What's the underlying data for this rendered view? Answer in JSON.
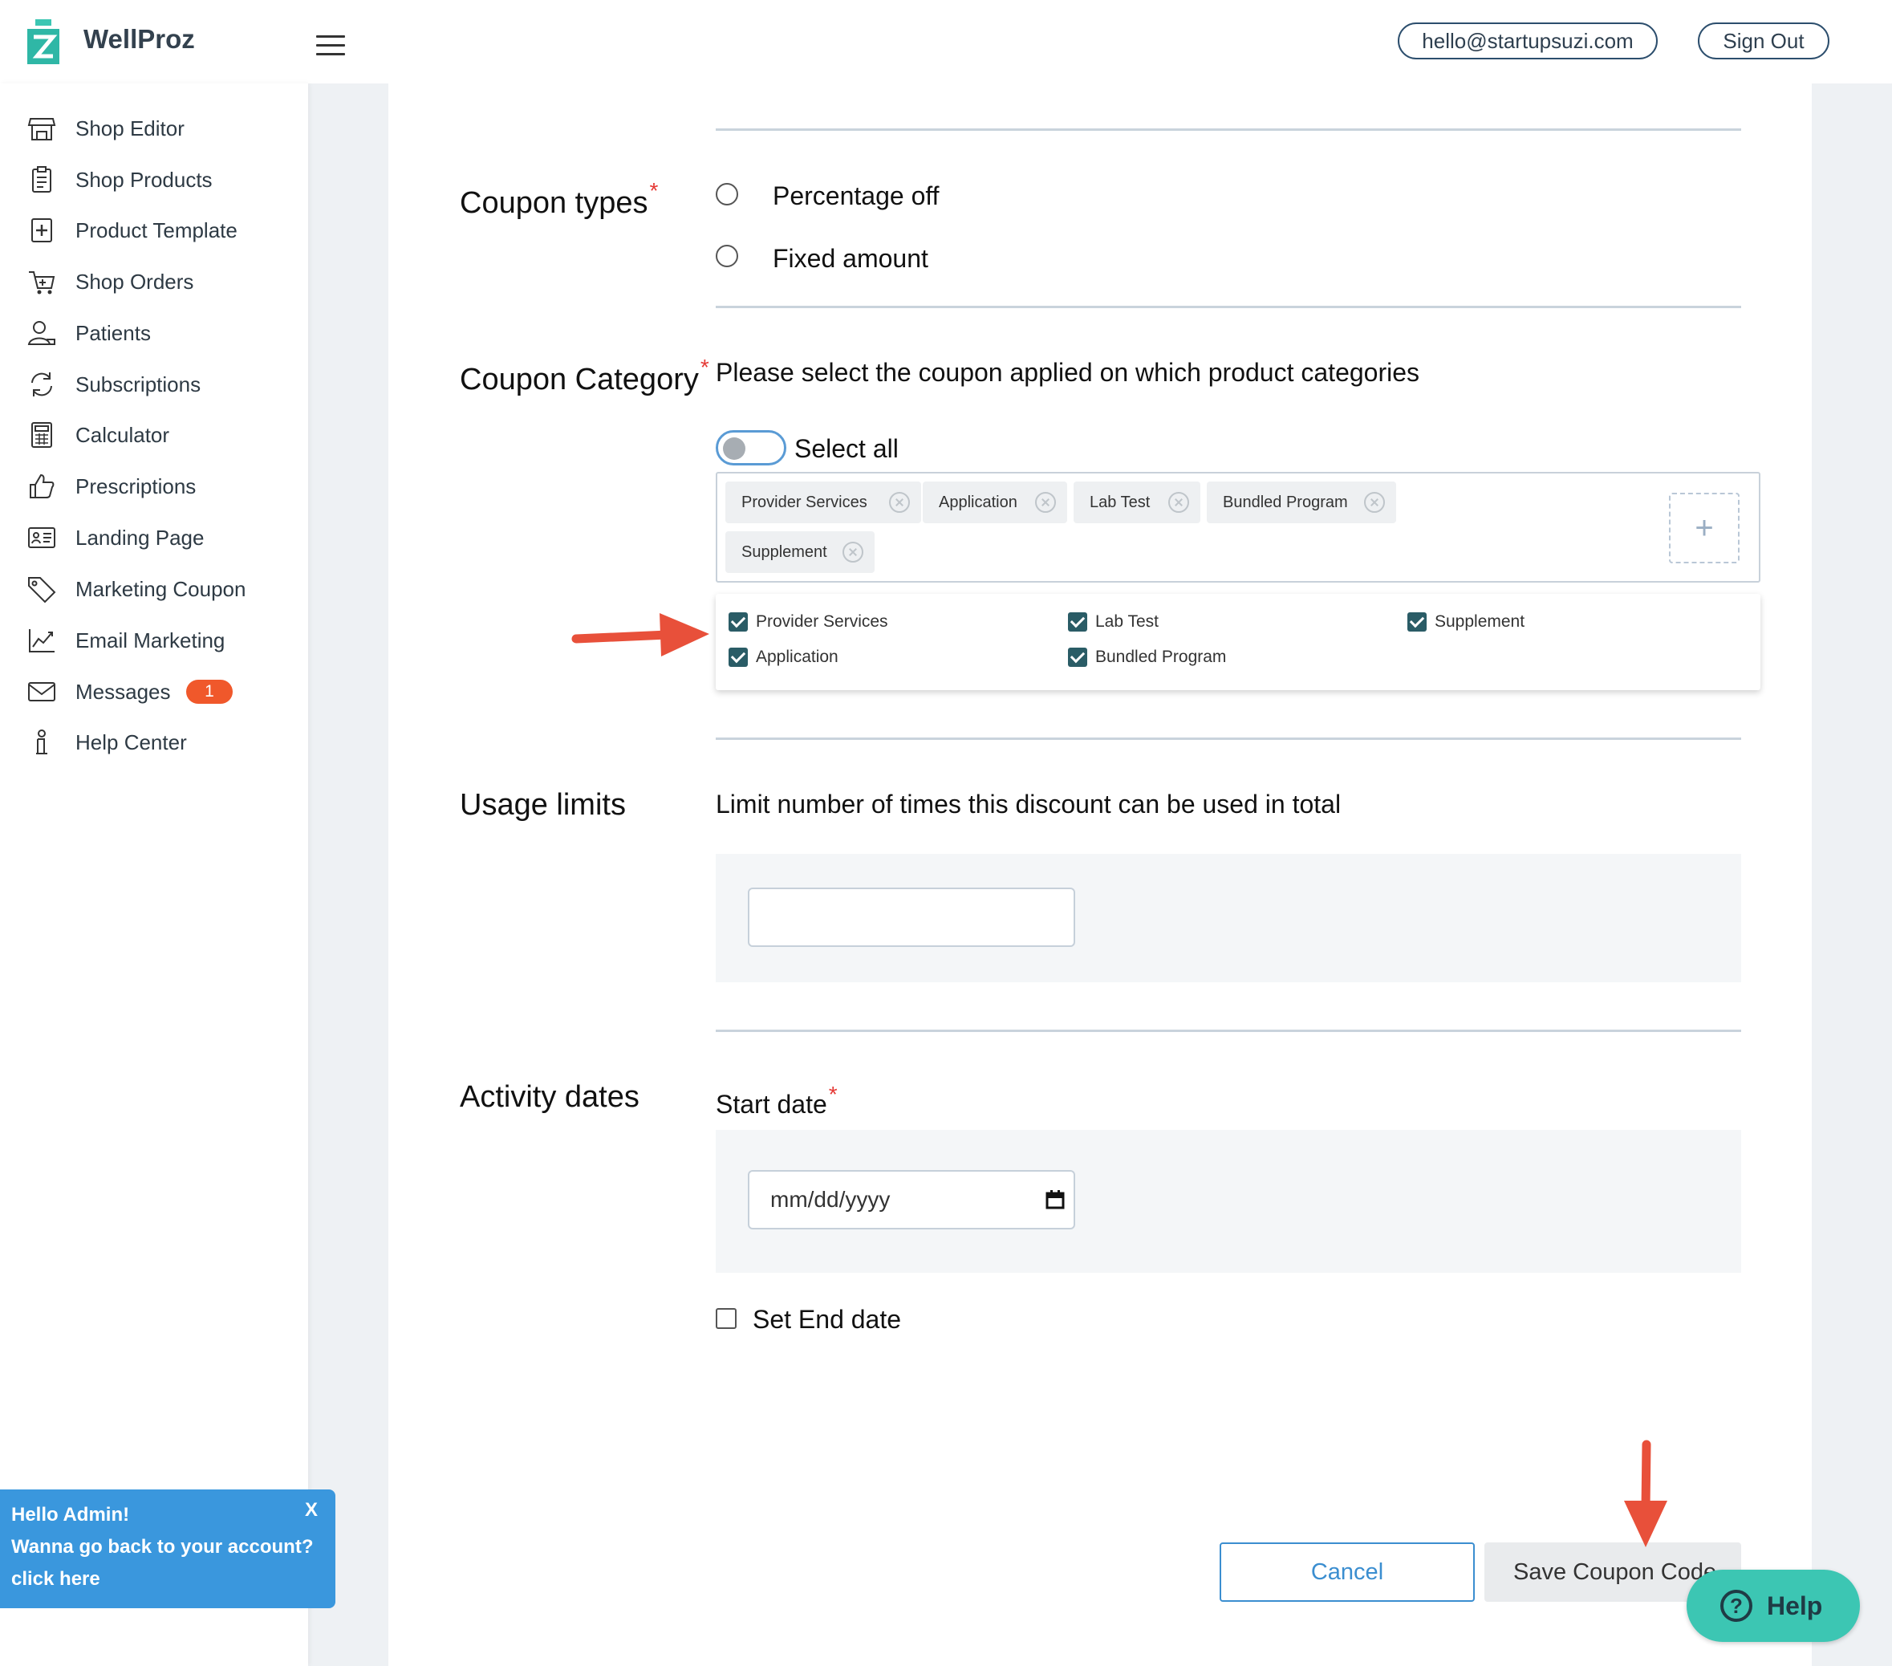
{
  "header": {
    "brand": "WellProz",
    "email": "hello@startupsuzi.com",
    "sign_out": "Sign Out"
  },
  "sidebar": {
    "items": [
      {
        "label": "Shop Editor",
        "icon": "store-icon"
      },
      {
        "label": "Shop Products",
        "icon": "clipboard-list-icon"
      },
      {
        "label": "Product Template",
        "icon": "plus-square-icon"
      },
      {
        "label": "Shop Orders",
        "icon": "cart-icon"
      },
      {
        "label": "Patients",
        "icon": "user-icon"
      },
      {
        "label": "Subscriptions",
        "icon": "refresh-icon"
      },
      {
        "label": "Calculator",
        "icon": "calculator-icon"
      },
      {
        "label": "Prescriptions",
        "icon": "thumbs-up-icon"
      },
      {
        "label": "Landing Page",
        "icon": "id-card-icon"
      },
      {
        "label": "Marketing Coupon",
        "icon": "tag-icon"
      },
      {
        "label": "Email Marketing",
        "icon": "chart-line-icon"
      },
      {
        "label": "Messages",
        "icon": "envelope-icon",
        "badge": "1"
      },
      {
        "label": "Help Center",
        "icon": "info-icon"
      }
    ]
  },
  "coupon_types": {
    "title": "Coupon types",
    "required_mark": "*",
    "options": [
      "Percentage off",
      "Fixed amount"
    ]
  },
  "coupon_category": {
    "title": "Coupon Category",
    "required_mark": "*",
    "description": "Please select the coupon applied on which product categories",
    "select_all": "Select all",
    "select_all_on": false,
    "selected_tags": [
      "Provider Services",
      "Application",
      "Lab Test",
      "Bundled Program",
      "Supplement"
    ],
    "add_symbol": "+",
    "options": [
      {
        "label": "Provider Services",
        "checked": true
      },
      {
        "label": "Application",
        "checked": true
      },
      {
        "label": "Lab Test",
        "checked": true
      },
      {
        "label": "Bundled Program",
        "checked": true
      },
      {
        "label": "Supplement",
        "checked": true
      }
    ]
  },
  "usage_limits": {
    "title": "Usage limits",
    "description": "Limit number of times this discount can be used in total",
    "value": ""
  },
  "activity_dates": {
    "title": "Activity dates",
    "start_label": "Start date",
    "required_mark": "*",
    "start_placeholder": "mm/dd/yyyy",
    "set_end_label": "Set End date",
    "set_end_checked": false
  },
  "actions": {
    "cancel": "Cancel",
    "save": "Save Coupon Code"
  },
  "help_widget": {
    "symbol": "?",
    "label": "Help"
  },
  "admin_popup": {
    "line1": "Hello Admin!",
    "line2": "Wanna go back to your account?",
    "line3": "click here",
    "close": "X"
  },
  "colors": {
    "accent": "#3b8ed0",
    "badge": "#f0582b",
    "help": "#3cc6b3",
    "checkbox": "#2a5c66",
    "annotation_arrow": "#e8503a"
  }
}
